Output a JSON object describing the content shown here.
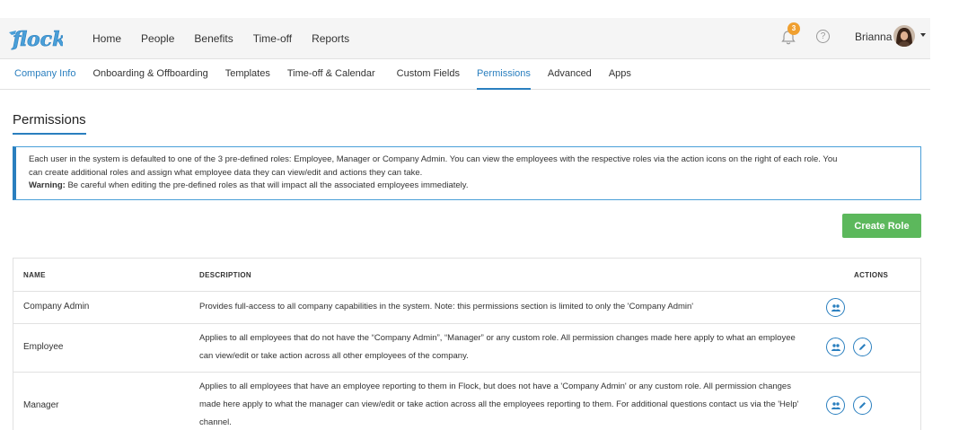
{
  "brand": {
    "logo_text": "flock",
    "accent": "#2a7fbf",
    "success": "#5cb85c",
    "badge": "#f0a030"
  },
  "topnav": {
    "items": [
      "Home",
      "People",
      "Benefits",
      "Time-off",
      "Reports"
    ]
  },
  "notifications": {
    "count": "3",
    "icon": "bell-icon"
  },
  "help": {
    "icon": "question-icon",
    "glyph": "?"
  },
  "user": {
    "name": "Brianna"
  },
  "subnav": {
    "tabs": [
      "Company Info",
      "Onboarding & Offboarding",
      "Templates",
      "Time-off & Calendar",
      "Custom Fields",
      "Permissions",
      "Advanced",
      "Apps"
    ],
    "active": "Permissions"
  },
  "page": {
    "title": "Permissions"
  },
  "info": {
    "line1": "Each user in the system is defaulted to one of the 3 pre-defined roles: Employee, Manager or Company Admin. You can view the employees with the respective roles via the action icons on the right of each role. You",
    "line2": "can create additional roles and assign what employee data they can view/edit and actions they can take.",
    "warning_label": "Warning:",
    "warning_text": " Be careful when editing the pre-defined roles as that will impact all the associated employees immediately."
  },
  "create_button": "Create Role",
  "table": {
    "headers": {
      "name": "NAME",
      "description": "DESCRIPTION",
      "actions": "ACTIONS"
    },
    "rows": [
      {
        "name": "Company Admin",
        "description": "Provides full-access to all company capabilities in the system. Note: this permissions section is limited to only the 'Company Admin'"
      },
      {
        "name": "Employee",
        "description": "Applies to all employees that do not have the “Company Admin”, “Manager” or any custom role. All permission changes made here apply to what an employee can view/edit or take action across all other employees of the company."
      },
      {
        "name": "Manager",
        "description": "Applies to all employees that have an employee reporting to them in Flock, but does not have a 'Company Admin' or any custom role. All permission changes made here apply to what the manager can view/edit or take action across all the employees reporting to them. For additional questions contact us via the 'Help' channel."
      }
    ]
  }
}
